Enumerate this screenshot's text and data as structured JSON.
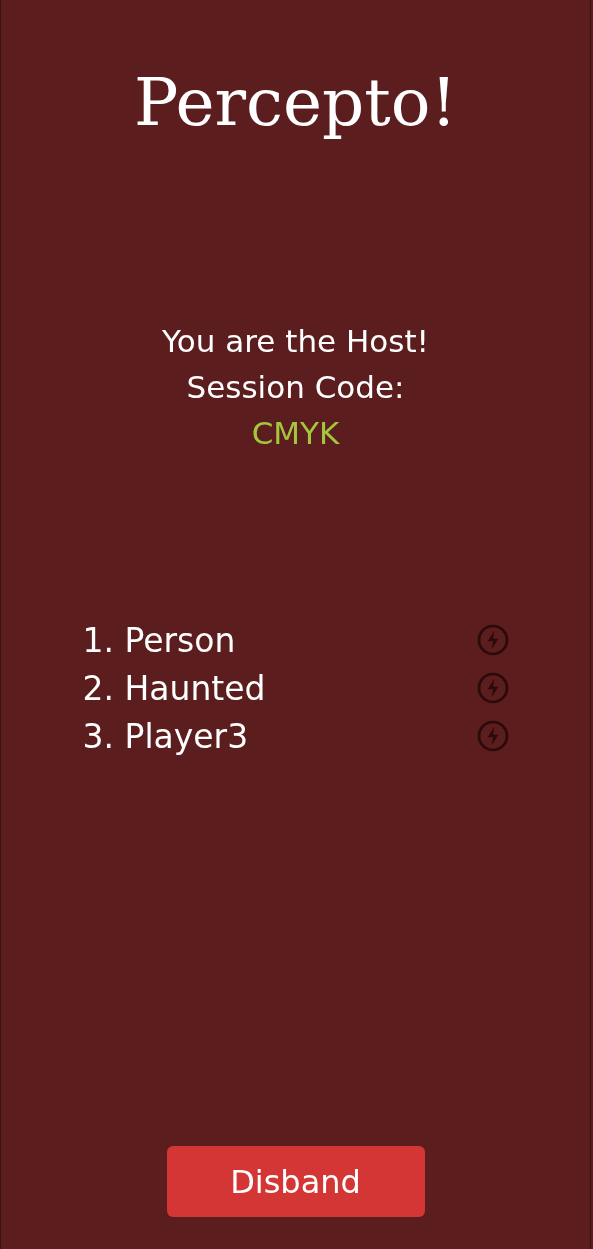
{
  "title": "Percepto!",
  "host_message": "You are the Host!",
  "session_label": "Session Code:",
  "session_code": "CMYK",
  "players": [
    {
      "name": "1. Person"
    },
    {
      "name": "2. Haunted"
    },
    {
      "name": "3. Player3"
    }
  ],
  "disband_button": "Disband"
}
